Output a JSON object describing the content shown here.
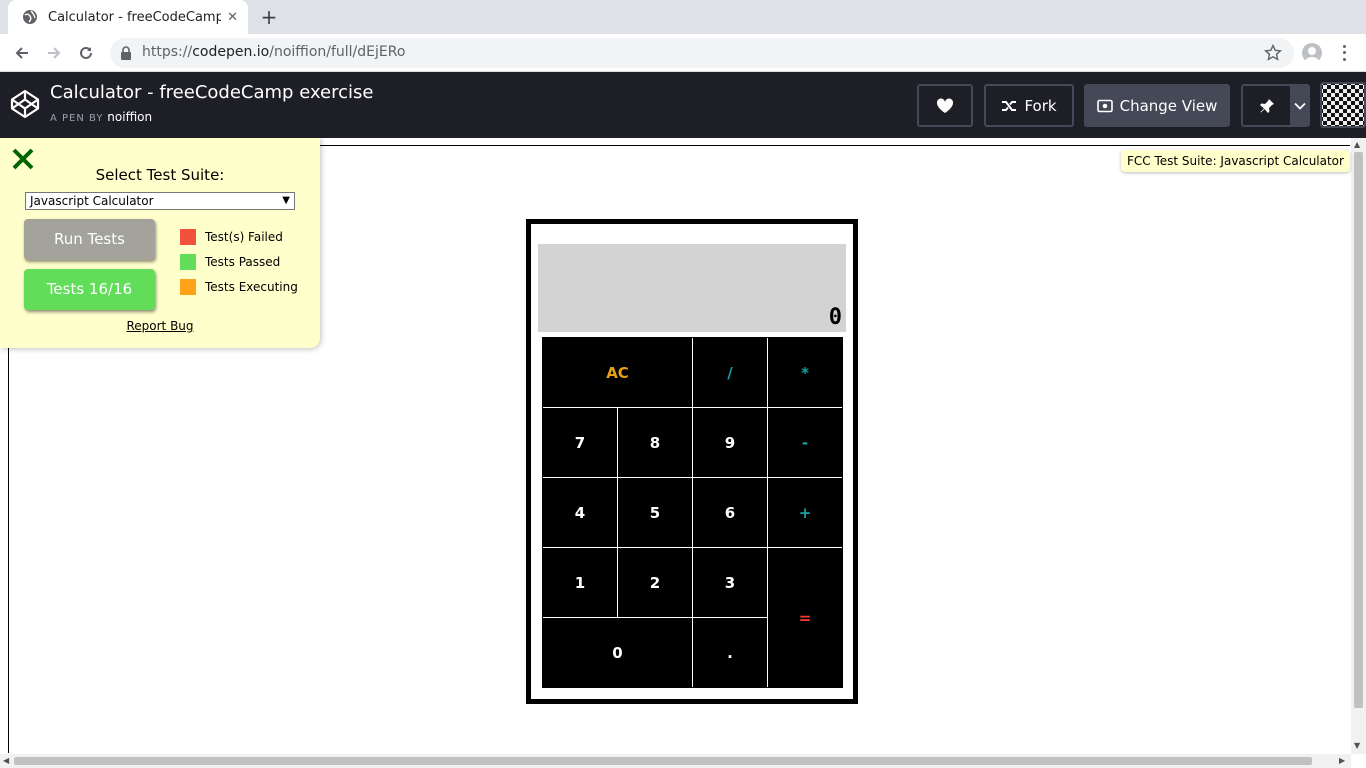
{
  "browser": {
    "tab_title": "Calculator - freeCodeCamp exercise",
    "tab_close": "✕",
    "new_tab": "+",
    "url_scheme": "https://",
    "url_host": "codepen.io",
    "url_path": "/noiffion/full/dEjERo"
  },
  "header": {
    "pen_title": "Calculator - freeCodeCamp exercise",
    "byline_prefix": "A PEN BY",
    "author": "noiffion",
    "fork_label": "Fork",
    "change_view_label": "Change View"
  },
  "tooltip": "FCC Test Suite: Javascript Calculator",
  "test_panel": {
    "select_label": "Select Test Suite:",
    "selected_suite": "Javascript Calculator",
    "run_button": "Run Tests",
    "tests_button": "Tests 16/16",
    "legend": [
      {
        "label": "Test(s) Failed",
        "color": "#f2513a"
      },
      {
        "label": "Tests Passed",
        "color": "#62dd5a"
      },
      {
        "label": "Tests Executing",
        "color": "#ffa21a"
      }
    ],
    "report_bug": "Report Bug"
  },
  "calculator": {
    "display": "0",
    "keys": [
      {
        "label": "AC",
        "color": "#e6a117"
      },
      {
        "label": "/",
        "color": "#17a2a2"
      },
      {
        "label": "*",
        "color": "#17a2a2"
      },
      {
        "label": "7",
        "color": "#ffffff"
      },
      {
        "label": "8",
        "color": "#ffffff"
      },
      {
        "label": "9",
        "color": "#ffffff"
      },
      {
        "label": "-",
        "color": "#17a2a2"
      },
      {
        "label": "4",
        "color": "#ffffff"
      },
      {
        "label": "5",
        "color": "#ffffff"
      },
      {
        "label": "6",
        "color": "#ffffff"
      },
      {
        "label": "+",
        "color": "#17a2a2"
      },
      {
        "label": "1",
        "color": "#ffffff"
      },
      {
        "label": "2",
        "color": "#ffffff"
      },
      {
        "label": "3",
        "color": "#ffffff"
      },
      {
        "label": "=",
        "color": "#ff3b2f"
      },
      {
        "label": "0",
        "color": "#ffffff"
      },
      {
        "label": ".",
        "color": "#ffffff"
      }
    ]
  },
  "colors": {
    "codepen_header": "#1e1f26",
    "panel_bg": "#ffffcc"
  }
}
